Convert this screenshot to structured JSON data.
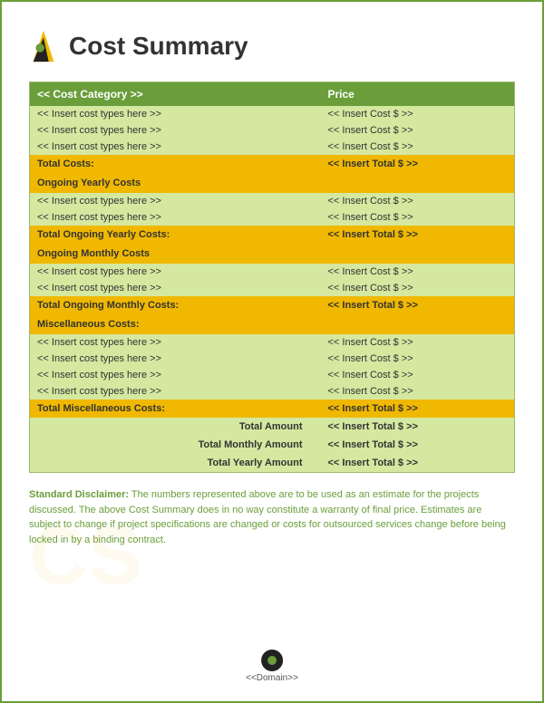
{
  "page": {
    "title": "Cost Summary",
    "border_color": "#6a9e3a"
  },
  "table": {
    "header": {
      "category_label": "<< Cost Category >>",
      "price_label": "Price"
    },
    "initial_costs": {
      "rows": [
        {
          "category": "<< Insert cost types here >>",
          "price": "<< Insert Cost $ >>"
        },
        {
          "category": "<< Insert cost types here >>",
          "price": "<< Insert Cost $ >>"
        },
        {
          "category": "<< Insert cost types here >>",
          "price": "<< Insert Cost $ >>"
        }
      ],
      "total_label": "Total Costs:",
      "total_value": "<< Insert Total $ >>"
    },
    "ongoing_yearly": {
      "section_label": "Ongoing Yearly Costs",
      "rows": [
        {
          "category": "<< Insert cost types here >>",
          "price": "<< Insert Cost $ >>"
        },
        {
          "category": "<< Insert cost types here >>",
          "price": "<< Insert Cost $ >>"
        }
      ],
      "total_label": "Total Ongoing Yearly Costs:",
      "total_value": "<< Insert Total $ >>"
    },
    "ongoing_monthly": {
      "section_label": "Ongoing Monthly Costs",
      "rows": [
        {
          "category": "<< Insert cost types here >>",
          "price": "<< Insert Cost $ >>"
        },
        {
          "category": "<< Insert cost types here >>",
          "price": "<< Insert Cost $ >>"
        }
      ],
      "total_label": "Total Ongoing Monthly Costs:",
      "total_value": "<< Insert Total $ >>"
    },
    "miscellaneous": {
      "section_label": "Miscellaneous Costs:",
      "rows": [
        {
          "category": "<< Insert cost types here >>",
          "price": "<< Insert Cost $ >>"
        },
        {
          "category": "<< Insert cost types here >>",
          "price": "<< Insert Cost $ >>"
        },
        {
          "category": "<< Insert cost types here >>",
          "price": "<< Insert Cost $ >>"
        },
        {
          "category": "<< Insert cost types here >>",
          "price": "<< Insert Cost $ >>"
        }
      ],
      "total_label": "Total Miscellaneous Costs:",
      "total_value": "<< Insert Total $ >>"
    },
    "summary": {
      "total_amount_label": "Total Amount",
      "total_amount_value": "<< Insert Total $ >>",
      "total_monthly_label": "Total Monthly Amount",
      "total_monthly_value": "<< Insert Total $ >>",
      "total_yearly_label": "Total Yearly Amount",
      "total_yearly_value": "<< Insert Total $ >>"
    }
  },
  "disclaimer": {
    "label": "Standard Disclaimer:",
    "text": " The numbers represented above are to be used as an estimate for the projects discussed. The above Cost Summary does in no way constitute a warranty of final price. Estimates are subject to change if project specifications are changed or costs for outsourced services change before being locked in by a binding contract."
  },
  "footer": {
    "domain_text": "<<Domain>>"
  }
}
